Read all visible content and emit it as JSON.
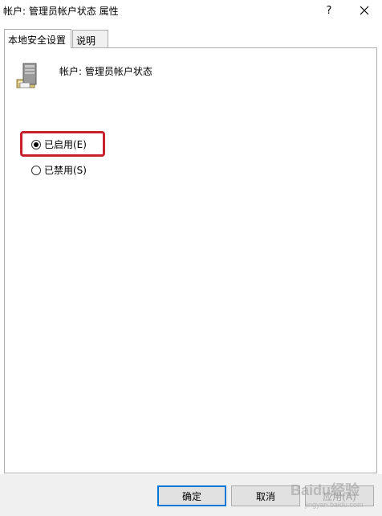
{
  "window": {
    "title": "帐户: 管理员帐户状态 属性",
    "help_label": "?"
  },
  "tabs": [
    {
      "label": "本地安全设置",
      "active": true
    },
    {
      "label": "说明",
      "active": false
    }
  ],
  "policy": {
    "name": "帐户: 管理员帐户状态",
    "icon": "server-icon"
  },
  "options": {
    "enabled_label": "已启用(E)",
    "disabled_label": "已禁用(S)",
    "selected": "enabled"
  },
  "buttons": {
    "ok_label": "确定",
    "cancel_label": "取消",
    "apply_label": "应用(A)"
  },
  "watermark": {
    "text": "Baidu经验",
    "subtext": "jingyan.baidu.com"
  },
  "colors": {
    "highlight": "#c8202f",
    "default_button_border": "#0078d7",
    "disabled_text": "#a0a0a0"
  }
}
